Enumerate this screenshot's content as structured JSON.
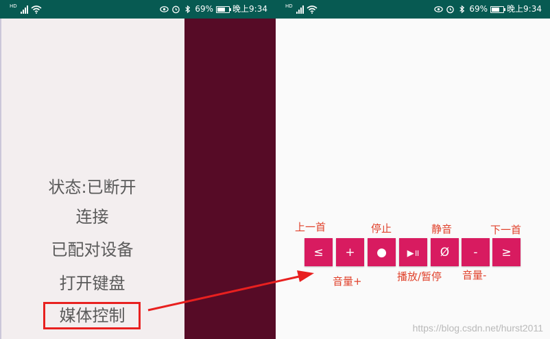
{
  "status_bar": {
    "battery": "69%",
    "battery_level": 0.69,
    "time": "晚上9:34",
    "network_tag": "HD"
  },
  "left_screen": {
    "status_text": "状态:已断开",
    "menu": {
      "connect": "连接",
      "paired_devices": "已配对设备",
      "open_keyboard": "打开键盘",
      "media_control": "媒体控制"
    }
  },
  "right_screen": {
    "buttons": {
      "prev": "≤",
      "vol_up": "+",
      "stop": "●",
      "play_pause": "▶॥",
      "mute": "Ø",
      "vol_down": "-",
      "next": "≥"
    },
    "labels": {
      "prev": "上一首",
      "stop": "停止",
      "mute": "静音",
      "next": "下一首",
      "vol_up": "音量+",
      "play_pause": "播放/暂停",
      "vol_down": "音量-"
    }
  },
  "watermark": "https://blog.csdn.net/hurst2011",
  "colors": {
    "status_bar": "#075a52",
    "left_panel": "#f3eeef",
    "dark_panel": "#560b26",
    "button": "#d81b60",
    "annotation": "#e8201f",
    "label_text": "#e0402a"
  }
}
